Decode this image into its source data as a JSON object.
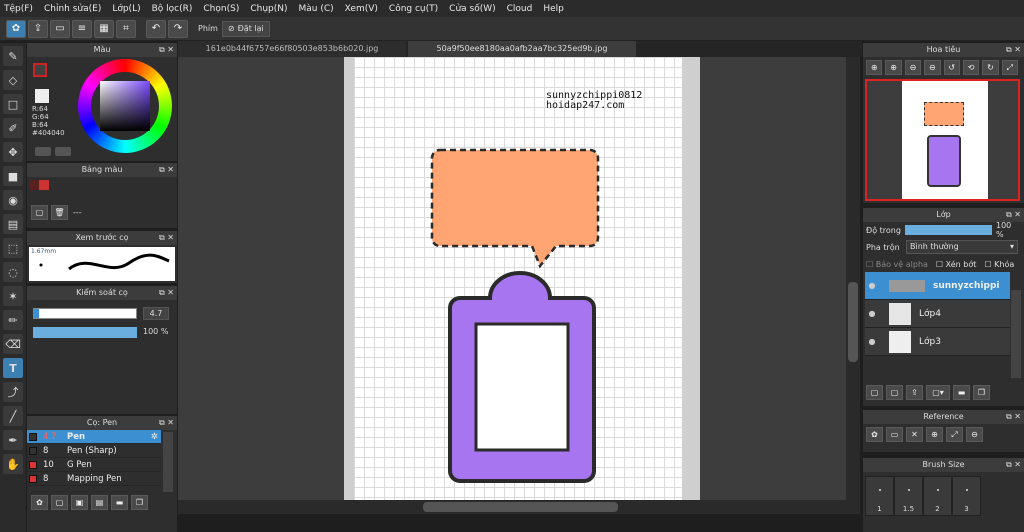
{
  "menu": [
    "Tệp(F)",
    "Chỉnh sửa(E)",
    "Lớp(L)",
    "Bộ lọc(R)",
    "Chọn(S)",
    "Chụp(N)",
    "Màu (C)",
    "Xem(V)",
    "Công cụ(T)",
    "Cửa số(W)",
    "Cloud",
    "Help"
  ],
  "toolbar": {
    "phim_label": "Phím",
    "reset_label": "Đặt lại"
  },
  "color_panel": {
    "title": "Màu",
    "r": "R:64",
    "g": "G:64",
    "b": "B:64",
    "hex": "#404040"
  },
  "palette_panel": {
    "title": "Bảng màu",
    "placeholder": "---"
  },
  "brush_preview": {
    "title": "Xem trước cọ",
    "size": "1.67mm"
  },
  "brush_control": {
    "title": "Kiểm soát cọ",
    "size_value": "4.7",
    "opacity_value": "100 %"
  },
  "brush_panel": {
    "title": "Cọ: Pen",
    "items": [
      {
        "size": "4.7",
        "name": "Pen",
        "color": "#333333"
      },
      {
        "size": "8",
        "name": "Pen (Sharp)",
        "color": "#333333"
      },
      {
        "size": "10",
        "name": "G Pen",
        "color": "#d33"
      },
      {
        "size": "8",
        "name": "Mapping Pen",
        "color": "#d33"
      }
    ]
  },
  "tabs": [
    "161e0b44f6757e66f80503e853b6b020.jpg",
    "50a9f50ee8180aa0afb2aa7bc325ed9b.jpg"
  ],
  "canvas": {
    "watermark_line1": "sunnyzchippi0812",
    "watermark_line2": "hoidap247.com"
  },
  "navigator": {
    "title": "Hoa tiêu"
  },
  "layer_panel": {
    "title": "Lớp",
    "opacity_label": "Độ trong",
    "opacity_value": "100 %",
    "blend_label": "Pha trộn",
    "blend_value": "Bình thường",
    "protect_alpha": "Bảo vệ alpha",
    "clip": "Xén bớt",
    "lock": "Khóa",
    "layers": [
      {
        "name": "sunnyzchippi"
      },
      {
        "name": "Lớp4"
      },
      {
        "name": "Lớp3"
      }
    ]
  },
  "reference": {
    "title": "Reference"
  },
  "brush_size": {
    "title": "Brush Size",
    "sizes": [
      "1",
      "1.5",
      "2",
      "3"
    ]
  },
  "colors": {
    "speech": "#ffa574",
    "frame": "#a875f0",
    "accent": "#3c8fd0"
  }
}
